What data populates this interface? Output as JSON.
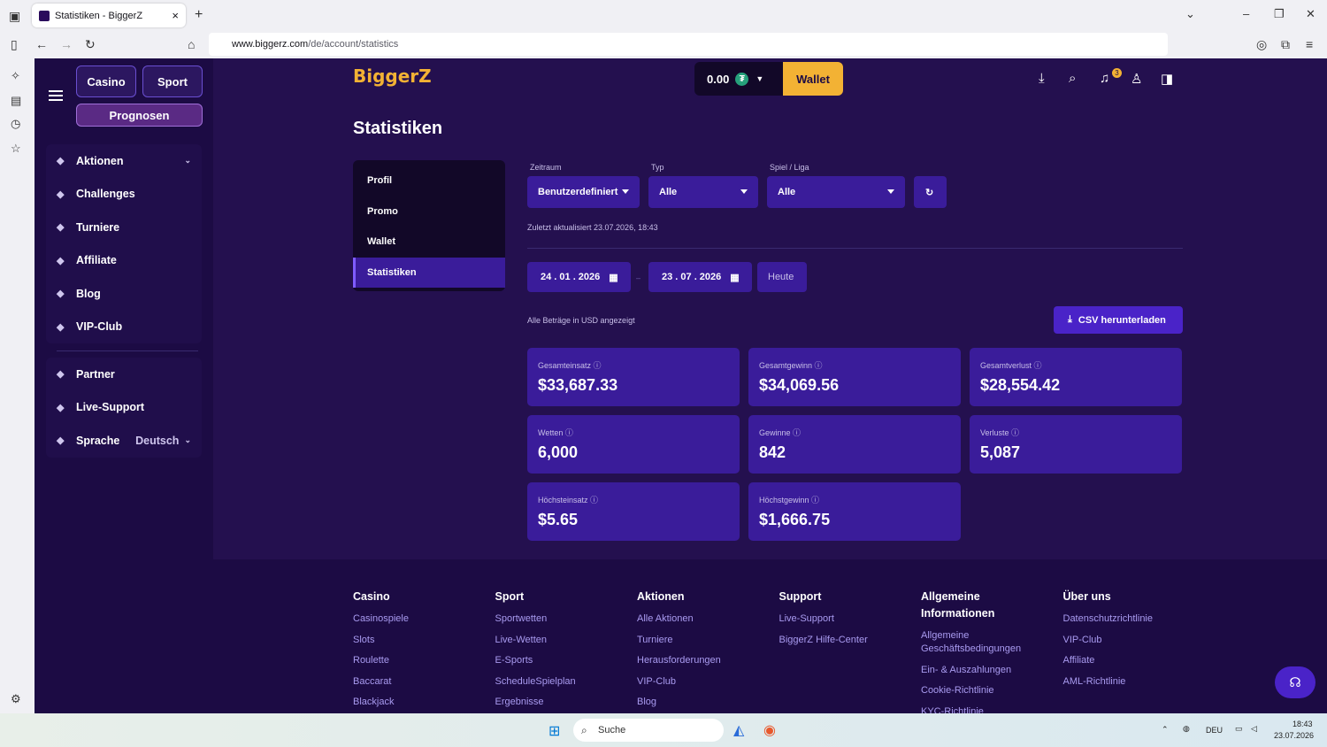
{
  "browser": {
    "tab_title": "Statistiken - BiggerZ",
    "url_domain": "www.biggerz.com",
    "url_path": "/de/account/statistics"
  },
  "app": {
    "top_buttons": {
      "casino": "Casino",
      "sport": "Sport",
      "prognosen": "Prognosen"
    },
    "menu1": [
      {
        "label": "Aktionen",
        "icon": "gift-icon",
        "chevron": true
      },
      {
        "label": "Challenges",
        "icon": "flask-icon"
      },
      {
        "label": "Turniere",
        "icon": "medal-icon"
      },
      {
        "label": "Affiliate",
        "icon": "users-icon"
      },
      {
        "label": "Blog",
        "icon": "blog-icon"
      },
      {
        "label": "VIP-Club",
        "icon": "trophy-icon"
      }
    ],
    "menu2": [
      {
        "label": "Partner",
        "icon": "partner-icon"
      },
      {
        "label": "Live-Support",
        "icon": "headset-icon"
      },
      {
        "label": "Sprache",
        "icon": "globe-icon",
        "value": "Deutsch"
      }
    ],
    "logo": "BiggerZ",
    "balance": "0.00",
    "wallet": "Wallet",
    "notifications": "3"
  },
  "page": {
    "title": "Statistiken",
    "subnav": [
      "Profil",
      "Promo",
      "Wallet",
      "Statistiken"
    ],
    "filters": {
      "zeitraum_label": "Zeitraum",
      "zeitraum": "Benutzerdefiniert",
      "typ_label": "Typ",
      "typ": "Alle",
      "spiel_label": "Spiel / Liga",
      "spiel": "Alle"
    },
    "last_updated": "Zuletzt aktualisiert 23.07.2026, 18:43",
    "date_from": "24 . 01 . 2026",
    "date_sep": "–",
    "date_to": "23 . 07 . 2026",
    "today": "Heute",
    "currency_note": "Alle Beträge in USD angezeigt",
    "csv": "CSV herunterladen",
    "stats": [
      {
        "label": "Gesamteinsatz",
        "value": "$33,687.33"
      },
      {
        "label": "Gesamtgewinn",
        "value": "$34,069.56"
      },
      {
        "label": "Gesamtverlust",
        "value": "$28,554.42"
      },
      {
        "label": "Wetten",
        "value": "6,000"
      },
      {
        "label": "Gewinne",
        "value": "842"
      },
      {
        "label": "Verluste",
        "value": "5,087"
      },
      {
        "label": "Höchsteinsatz",
        "value": "$5.65"
      },
      {
        "label": "Höchstgewinn",
        "value": "$1,666.75"
      }
    ]
  },
  "footer": [
    {
      "heading": "Casino",
      "links": [
        "Casinospiele",
        "Slots",
        "Roulette",
        "Baccarat",
        "Blackjack"
      ]
    },
    {
      "heading": "Sport",
      "links": [
        "Sportwetten",
        "Live-Wetten",
        "E-Sports",
        "ScheduleSpielplan",
        "Ergebnisse"
      ]
    },
    {
      "heading": "Aktionen",
      "links": [
        "Alle Aktionen",
        "Turniere",
        "Herausforderungen",
        "VIP-Club",
        "Blog"
      ]
    },
    {
      "heading": "Support",
      "links": [
        "Live-Support",
        "BiggerZ Hilfe-Center"
      ]
    },
    {
      "heading": "Allgemeine Informationen",
      "links": [
        "Allgemeine Geschäftsbedingungen",
        "Ein- & Auszahlungen",
        "Cookie-Richtlinie",
        "KYC-Richtlinie"
      ]
    },
    {
      "heading": "Über uns",
      "links": [
        "Datenschutzrichtlinie",
        "VIP-Club",
        "Affiliate",
        "AML-Richtlinie"
      ]
    }
  ],
  "taskbar": {
    "search": "Suche",
    "lang": "DEU",
    "time": "18:43",
    "date": "23.07.2026"
  }
}
